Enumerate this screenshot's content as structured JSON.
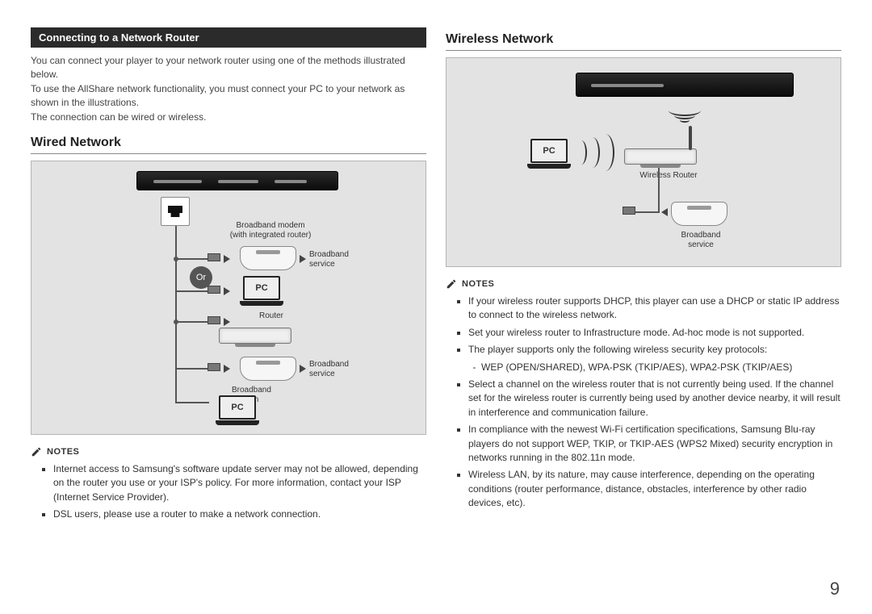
{
  "left": {
    "section_bar": "Connecting to a Network Router",
    "intro_p1": "You can connect your player to your network router using one of the methods illustrated below.",
    "intro_p2": "To use the AllShare network functionality, you must connect your PC to your network as shown in the illustrations.",
    "intro_p3": "The connection can be wired or wireless.",
    "wired_heading": "Wired Network",
    "diagram": {
      "broadband_modem_router": "Broadband modem\n(with integrated router)",
      "broadband_service": "Broadband service",
      "or": "Or",
      "router": "Router",
      "broadband_modem": "Broadband modem",
      "pc": "PC"
    },
    "notes_label": "NOTES",
    "notes": [
      "Internet access to Samsung's software update server may not be allowed, depending on the router you use or your ISP's policy. For more information, contact your ISP (Internet Service Provider).",
      "DSL users, please use a router to make a network connection."
    ]
  },
  "right": {
    "wireless_heading": "Wireless Network",
    "diagram": {
      "wireless_router": "Wireless Router",
      "broadband_service": "Broadband service",
      "pc": "PC"
    },
    "notes_label": "NOTES",
    "notes": [
      "If your wireless router supports DHCP, this player can use a DHCP or static IP address to connect to the wireless network.",
      "Set your wireless router to Infrastructure mode. Ad-hoc mode is not supported.",
      "The player supports only the following wireless security key protocols:",
      "Select a channel on the wireless router that is not currently being used. If the channel set for the wireless router is currently being used by another device nearby, it will result in interference and communication failure.",
      "In compliance with the newest Wi-Fi certification specifications, Samsung Blu-ray players do not support WEP, TKIP, or TKIP-AES (WPS2 Mixed) security encryption in networks running in the 802.11n mode.",
      "Wireless LAN, by its nature, may cause interference, depending on the operating conditions (router performance, distance, obstacles, interference by other radio devices, etc)."
    ],
    "protocols_sub": "WEP (OPEN/SHARED), WPA-PSK (TKIP/AES), WPA2-PSK (TKIP/AES)"
  },
  "page_number": "9"
}
